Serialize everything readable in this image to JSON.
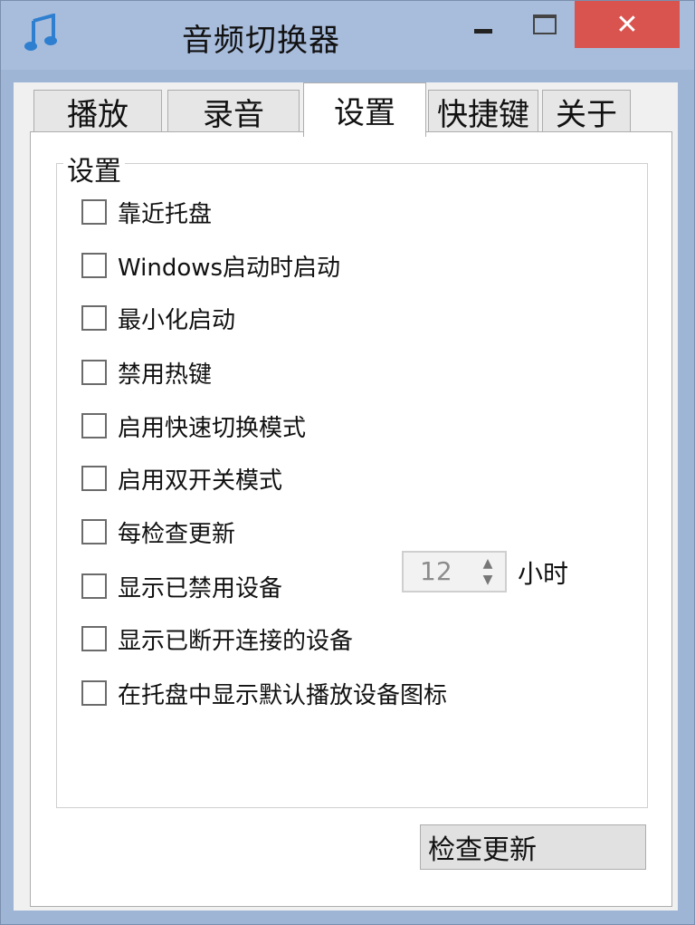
{
  "window": {
    "title": "音频切换器",
    "close_glyph": "✕"
  },
  "tabs": [
    {
      "label": "播放"
    },
    {
      "label": "录音"
    },
    {
      "label": "设置",
      "active": true
    },
    {
      "label": "快捷键"
    },
    {
      "label": "关于"
    }
  ],
  "settings": {
    "group_title": "设置",
    "options": [
      {
        "label": "靠近托盘",
        "checked": false
      },
      {
        "label": "Windows启动时启动",
        "checked": false
      },
      {
        "label": "最小化启动",
        "checked": false
      },
      {
        "label": "禁用热键",
        "checked": false
      },
      {
        "label": "启用快速切换模式",
        "checked": false
      },
      {
        "label": "启用双开关模式",
        "checked": false
      },
      {
        "label": "每检查更新",
        "checked": false
      },
      {
        "label": "显示已禁用设备",
        "checked": false
      },
      {
        "label": "显示已断开连接的设备",
        "checked": false
      },
      {
        "label": "在托盘中显示默认播放设备图标",
        "checked": false
      }
    ],
    "update_interval": {
      "value": "12",
      "unit": "小时",
      "enabled": false
    },
    "check_update_button": "检查更新"
  },
  "colors": {
    "titlebar": "#a8bcdc",
    "close": "#d9534f",
    "accent_icon": "#2f7fd0"
  },
  "icons": {
    "app": "music-note-icon",
    "minimize": "minimize-icon",
    "maximize": "maximize-icon",
    "close": "close-icon"
  }
}
